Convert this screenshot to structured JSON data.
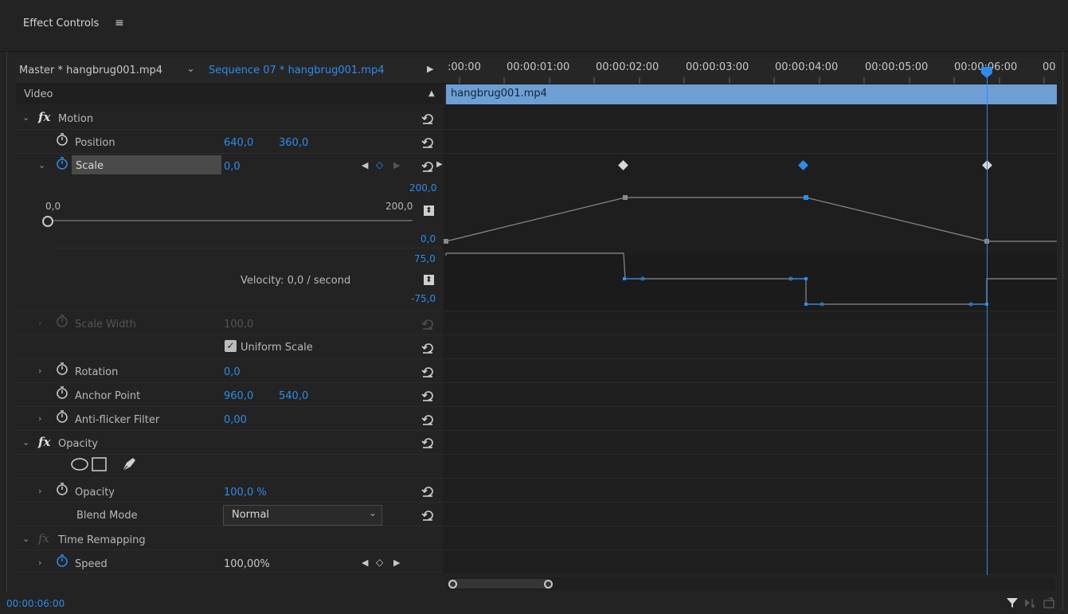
{
  "panel": {
    "title": "Effect Controls",
    "menu_icon": "hamburger-icon"
  },
  "source": {
    "master_label": "Master * hangbrug001.mp4",
    "sequence_label": "Sequence 07 * hangbrug001.mp4"
  },
  "timeline": {
    "ruler": [
      ":00:00",
      "00:00:01:00",
      "00:00:02:00",
      "00:00:03:00",
      "00:00:04:00",
      "00:00:05:00",
      "00:00:06:00",
      "00"
    ],
    "clip_name": "hangbrug001.mp4",
    "playhead_time": "00:00:06:00",
    "colors": {
      "accent": "#2d8ceb",
      "clip_bar": "#6e9fd4",
      "background": "#1e1e1e"
    }
  },
  "effects": {
    "video_label": "Video",
    "motion": {
      "label": "Motion",
      "position": {
        "label": "Position",
        "x": "640,0",
        "y": "360,0"
      },
      "scale": {
        "label": "Scale",
        "value": "0,0",
        "graph_max": "200,0",
        "graph_min": "0,0",
        "slider_min": "0,0",
        "slider_max": "200,0",
        "velocity_max": "75,0",
        "velocity_min": "-75,0",
        "velocity_label": "Velocity: 0,0 / second"
      },
      "scale_width": {
        "label": "Scale Width",
        "value": "100,0"
      },
      "uniform_scale": {
        "label": "Uniform Scale",
        "checked": true
      },
      "rotation": {
        "label": "Rotation",
        "value": "0,0"
      },
      "anchor_point": {
        "label": "Anchor Point",
        "x": "960,0",
        "y": "540,0"
      },
      "anti_flicker": {
        "label": "Anti-flicker Filter",
        "value": "0,00"
      }
    },
    "opacity": {
      "label": "Opacity",
      "opacity_param": {
        "label": "Opacity",
        "value": "100,0 %"
      },
      "blend_mode": {
        "label": "Blend Mode",
        "value": "Normal"
      }
    },
    "time_remapping": {
      "label": "Time Remapping",
      "speed": {
        "label": "Speed",
        "value": "100,00%"
      }
    }
  },
  "footer": {
    "timecode": "00:00:06:00"
  }
}
